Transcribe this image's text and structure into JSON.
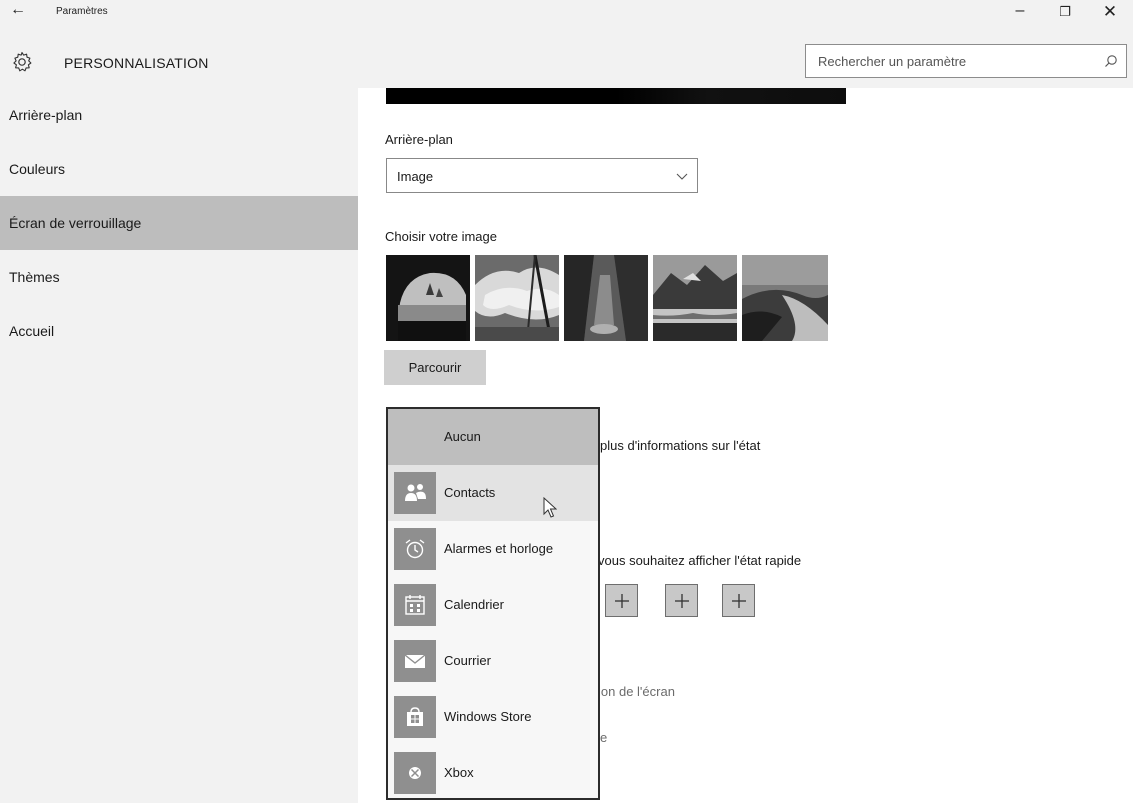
{
  "window": {
    "title": "Paramètres",
    "back_glyph": "←",
    "minimize_glyph": "–",
    "maximize_glyph": "❐",
    "close_glyph": "✕"
  },
  "header": {
    "section_title": "PERSONNALISATION",
    "search_placeholder": "Rechercher un paramètre",
    "gear_icon": "gear-icon",
    "search_icon": "search-icon"
  },
  "sidebar": {
    "items": [
      {
        "label": "Arrière-plan",
        "selected": false
      },
      {
        "label": "Couleurs",
        "selected": false
      },
      {
        "label": "Écran de verrouillage",
        "selected": true
      },
      {
        "label": "Thèmes",
        "selected": false
      },
      {
        "label": "Accueil",
        "selected": false
      }
    ]
  },
  "main": {
    "background_label": "Arrière-plan",
    "background_value": "Image",
    "choose_image_label": "Choisir votre image",
    "thumbnails": [
      {
        "name": "thumbnail-cave-sea"
      },
      {
        "name": "thumbnail-clouds"
      },
      {
        "name": "thumbnail-rock-falls"
      },
      {
        "name": "thumbnail-mountain-lake"
      },
      {
        "name": "thumbnail-dunes"
      }
    ],
    "browse_label": "Parcourir",
    "detailed_status_partial": "plus d'informations sur l'état",
    "quick_status_partial": "vous souhaitez afficher l'état rapide",
    "plus_glyph": "+",
    "screen_link_partial": "ion de l'écran",
    "link_partial_e": "e"
  },
  "flyout": {
    "none_label": "Aucun",
    "apps": [
      {
        "label": "Contacts",
        "icon": "contacts-icon",
        "hover": true
      },
      {
        "label": "Alarmes et horloge",
        "icon": "alarm-clock-icon",
        "hover": false
      },
      {
        "label": "Calendrier",
        "icon": "calendar-icon",
        "hover": false
      },
      {
        "label": "Courrier",
        "icon": "mail-icon",
        "hover": false
      },
      {
        "label": "Windows Store",
        "icon": "store-icon",
        "hover": false
      },
      {
        "label": "Xbox",
        "icon": "xbox-icon",
        "hover": false
      }
    ]
  }
}
